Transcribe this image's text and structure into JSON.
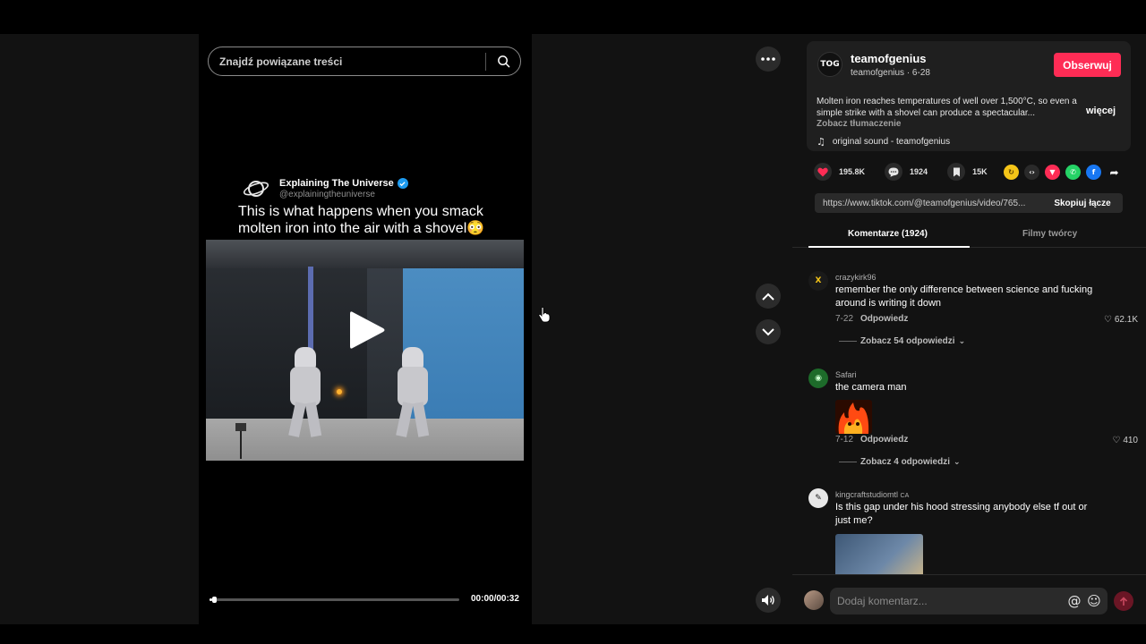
{
  "search": {
    "placeholder": "Znajdź powiązane treści",
    "icon": "search-icon"
  },
  "post": {
    "account_name": "Explaining The Universe",
    "account_handle": "@explainingtheuniverse",
    "caption": "This is what happens when you smack molten iron into the air with a shovel😳",
    "time": "00:00/00:32",
    "progress": 0.01
  },
  "creator": {
    "avatar_text": "TOG",
    "name": "teamofgenius",
    "sub": "teamofgenius · 6-28",
    "follow_label": "Obserwuj",
    "description": "Molten iron reaches temperatures of well over 1,500°C, so even a simple strike with a shovel can produce a spectacular...",
    "more_label": "więcej",
    "translate_label": "Zobacz tłumaczenie",
    "sound": "original sound - teamofgenius"
  },
  "stats": {
    "likes": "195.8K",
    "comments": "1924",
    "saves": "15K"
  },
  "link": {
    "url": "https://www.tiktok.com/@teamofgenius/video/765...",
    "copy_label": "Skopiuj łącze"
  },
  "tabs": {
    "comments": "Komentarze (1924)",
    "creator_videos": "Filmy twórcy"
  },
  "comments": [
    {
      "user": "crazykirk96",
      "text": "remember the only difference between science and fucking around is writing it down",
      "date": "7-22",
      "reply": "Odpowiedz",
      "likes": "62.1K",
      "replies": "Zobacz 54 odpowiedzi"
    },
    {
      "user": "Safari",
      "text": "the camera man",
      "date": "7-12",
      "reply": "Odpowiedz",
      "likes": "410",
      "replies": "Zobacz 4 odpowiedzi"
    },
    {
      "user": "kingcraftstudiomtl",
      "badge": "CA",
      "text": "Is this gap under his hood stressing anybody else tf out or just me?"
    }
  ],
  "comment_input": {
    "placeholder": "Dodaj komentarz...",
    "mention_icon": "@",
    "emoji_icon": "☺"
  },
  "colors": {
    "accent": "#fe2c55",
    "verified": "#1d9bf0",
    "panel_bg": "#121212",
    "card_bg": "#1f1f1f"
  }
}
